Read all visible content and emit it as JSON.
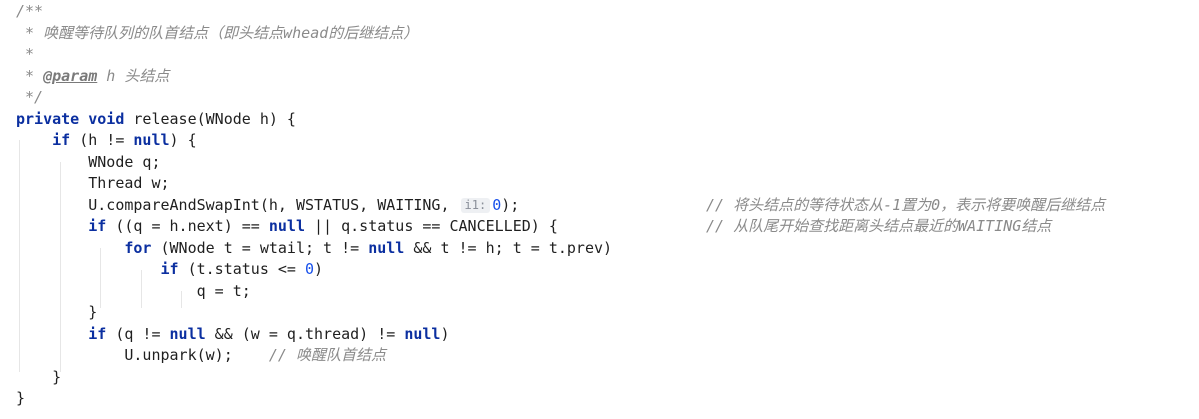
{
  "doc": {
    "c1": "/**",
    "c2": " * 唤醒等待队列的队首结点（即头结点",
    "c2_em": "whead",
    "c2_end": "的后继结点）",
    "c3": " *",
    "c4_pre": " * ",
    "c4_tag": "@param",
    "c4_rest": " h 头结点",
    "c5": " */"
  },
  "code": {
    "private_kw": "private",
    "void_kw": "void",
    "sig_rest": " release(WNode h) {",
    "if_kw": "if",
    "null_kw": "null",
    "for_kw": "for",
    "if1_mid": " (h != ",
    "if1_end": ") {",
    "l8": "WNode q;",
    "l9": "Thread w;",
    "l10_pre": "U.compareAndSwapInt(h, WSTATUS, WAITING, ",
    "l10_hint": "i1:",
    "l10_num": "0",
    "l10_end": ");",
    "l10_comment": "// 将头结点的等待状态从-1置为0，表示将要唤醒后继结点",
    "l11_pre": " ((q = h.next) == ",
    "l11_end": " || q.status == CANCELLED) {",
    "l11_comment": "// 从队尾开始查找距离头结点最近的WAITING结点",
    "l12_pre": " (WNode t = wtail; t != ",
    "l12_end": " && t != h; t = t.prev)",
    "l13_pre": " (t.status <= ",
    "l13_num": "0",
    "l13_end": ")",
    "l14": "q = t;",
    "l15": "}",
    "l16_pre": " (q != ",
    "l16_mid": " && (w = q.thread) != ",
    "l16_end": ")",
    "l17": "U.unpark(w);",
    "l17_comment": "// 唤醒队首结点",
    "l18": "}",
    "l19": "}"
  },
  "colors": {
    "keyword": "#0b2fa0",
    "comment": "#8a8a8a",
    "number": "#1750eb",
    "text": "#1f1f1f"
  }
}
